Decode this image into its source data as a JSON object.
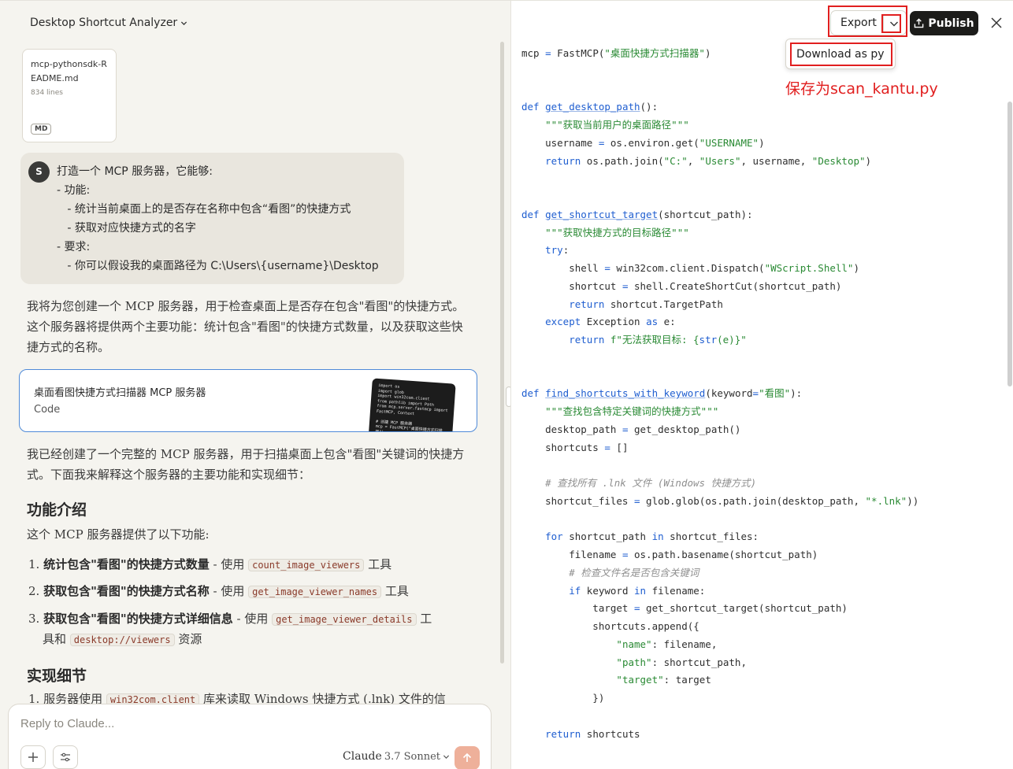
{
  "left": {
    "title": "Desktop Shortcut Analyzer",
    "file": {
      "name": "mcp-pythonsdk-README.md",
      "lines": "834 lines",
      "badge": "MD"
    },
    "user": {
      "avatar": "S",
      "text": "打造一个 MCP 服务器，它能够:\n- 功能:\n   - 统计当前桌面上的是否存在名称中包含“看图”的快捷方式\n   - 获取对应快捷方式的名字\n- 要求:\n   - 你可以假设我的桌面路径为 C:\\Users\\{username}\\Desktop"
    },
    "response_intro": "我将为您创建一个 MCP 服务器，用于检查桌面上是否存在包含\"看图\"的快捷方式。这个服务器将提供两个主要功能：统计包含\"看图\"的快捷方式数量，以及获取这些快捷方式的名称。",
    "artifact": {
      "title": "桌面看图快捷方式扫描器 MCP 服务器",
      "type": "Code",
      "thumb": "import os\nimport glob\nimport win32com.client\nfrom pathlib import Path\nfrom mcp.server.fastmcp import\nFastMCP, Context\n\n# 创建 MCP 服务器\nmcp = FastMCP(\"桌面快捷方式扫描\n器\")"
    },
    "response_2": "我已经创建了一个完整的 MCP 服务器，用于扫描桌面上包含\"看图\"关键词的快捷方式。下面我来解释这个服务器的主要功能和实现细节：",
    "h_features": "功能介绍",
    "features_intro": "这个 MCP 服务器提供了以下功能:",
    "features": [
      {
        "num": "1.",
        "bold": "统计包含\"看图\"的快捷方式数量",
        "mid": " - 使用 ",
        "code": "count_image_viewers",
        "tail": " 工具"
      },
      {
        "num": "2.",
        "bold": "获取包含\"看图\"的快捷方式名称",
        "mid": " - 使用 ",
        "code": "get_image_viewer_names",
        "tail": " 工具"
      },
      {
        "num": "3.",
        "bold": "获取包含\"看图\"的快捷方式详细信息",
        "mid": " - 使用 ",
        "code": "get_image_viewer_details",
        "tail": " 工",
        "line2a": "具和 ",
        "code2": "desktop://viewers",
        "line2b": " 资源"
      }
    ],
    "h_impl": "实现细节",
    "impl_item": {
      "num": "1.",
      "pre": "服务器使用 ",
      "code": "win32com.client",
      "post": " 库来读取 Windows 快捷方式 (.lnk) 文件的信"
    },
    "composer": {
      "placeholder": "Reply to Claude...",
      "model": "Claude",
      "version": "3.7 Sonnet"
    }
  },
  "right": {
    "export_label": "Export",
    "publish_label": "Publish",
    "menu_item": "Download as py",
    "annotation": "保存为scan_kantu.py",
    "code_lines": [
      [
        [
          "",
          "mcp "
        ],
        [
          "kw",
          "="
        ],
        [
          "",
          " FastMCP("
        ],
        [
          "st",
          "\"桌面快捷方式扫描器\""
        ],
        [
          "",
          ")"
        ]
      ],
      [],
      [],
      [
        [
          "kw",
          "def "
        ],
        [
          "fn",
          "get_desktop_path"
        ],
        [
          "",
          "():"
        ]
      ],
      [
        [
          "",
          "    "
        ],
        [
          "st",
          "\"\"\"获取当前用户的桌面路径\"\"\""
        ]
      ],
      [
        [
          "",
          "    username "
        ],
        [
          "kw",
          "="
        ],
        [
          "",
          " os.environ.get("
        ],
        [
          "st",
          "\"USERNAME\""
        ],
        [
          "",
          ")"
        ]
      ],
      [
        [
          "",
          "    "
        ],
        [
          "kw",
          "return"
        ],
        [
          "",
          " os.path.join("
        ],
        [
          "st",
          "\"C:\""
        ],
        [
          "",
          ", "
        ],
        [
          "st",
          "\"Users\""
        ],
        [
          "",
          ", username, "
        ],
        [
          "st",
          "\"Desktop\""
        ],
        [
          "",
          ")"
        ]
      ],
      [],
      [],
      [
        [
          "kw",
          "def "
        ],
        [
          "fn",
          "get_shortcut_target"
        ],
        [
          "",
          "(shortcut_path):"
        ]
      ],
      [
        [
          "",
          "    "
        ],
        [
          "st",
          "\"\"\"获取快捷方式的目标路径\"\"\""
        ]
      ],
      [
        [
          "",
          "    "
        ],
        [
          "kw",
          "try"
        ],
        [
          "",
          ":"
        ]
      ],
      [
        [
          "",
          "        shell "
        ],
        [
          "kw",
          "="
        ],
        [
          "",
          " win32com.client.Dispatch("
        ],
        [
          "st",
          "\"WScript.Shell\""
        ],
        [
          "",
          ")"
        ]
      ],
      [
        [
          "",
          "        shortcut "
        ],
        [
          "kw",
          "="
        ],
        [
          "",
          " shell.CreateShortCut(shortcut_path)"
        ]
      ],
      [
        [
          "",
          "        "
        ],
        [
          "kw",
          "return"
        ],
        [
          "",
          " shortcut.TargetPath"
        ]
      ],
      [
        [
          "",
          "    "
        ],
        [
          "kw",
          "except"
        ],
        [
          "",
          " Exception "
        ],
        [
          "kw",
          "as"
        ],
        [
          "",
          " e:"
        ]
      ],
      [
        [
          "",
          "        "
        ],
        [
          "kw",
          "return"
        ],
        [
          "",
          " "
        ],
        [
          "st",
          "f\"无法获取目标: {"
        ],
        [
          "kw",
          "str"
        ],
        [
          "st",
          "(e)}\""
        ]
      ],
      [],
      [],
      [
        [
          "kw",
          "def "
        ],
        [
          "fn",
          "find_shortcuts_with_keyword"
        ],
        [
          "",
          "(keyword"
        ],
        [
          "kw",
          "="
        ],
        [
          "st",
          "\"看图\""
        ],
        [
          "",
          "):"
        ]
      ],
      [
        [
          "",
          "    "
        ],
        [
          "st",
          "\"\"\"查找包含特定关键词的快捷方式\"\"\""
        ]
      ],
      [
        [
          "",
          "    desktop_path "
        ],
        [
          "kw",
          "="
        ],
        [
          "",
          " get_desktop_path()"
        ]
      ],
      [
        [
          "",
          "    shortcuts "
        ],
        [
          "kw",
          "="
        ],
        [
          "",
          " []"
        ]
      ],
      [],
      [
        [
          "",
          "    "
        ],
        [
          "cm",
          "# 查找所有 .lnk 文件 (Windows 快捷方式)"
        ]
      ],
      [
        [
          "",
          "    shortcut_files "
        ],
        [
          "kw",
          "="
        ],
        [
          "",
          " glob.glob(os.path.join(desktop_path, "
        ],
        [
          "st",
          "\"*.lnk\""
        ],
        [
          "",
          "))"
        ]
      ],
      [],
      [
        [
          "",
          "    "
        ],
        [
          "kw",
          "for"
        ],
        [
          "",
          " shortcut_path "
        ],
        [
          "kw",
          "in"
        ],
        [
          "",
          " shortcut_files:"
        ]
      ],
      [
        [
          "",
          "        filename "
        ],
        [
          "kw",
          "="
        ],
        [
          "",
          " os.path.basename(shortcut_path)"
        ]
      ],
      [
        [
          "",
          "        "
        ],
        [
          "cm",
          "# 检查文件名是否包含关键词"
        ]
      ],
      [
        [
          "",
          "        "
        ],
        [
          "kw",
          "if"
        ],
        [
          "",
          " keyword "
        ],
        [
          "kw",
          "in"
        ],
        [
          "",
          " filename:"
        ]
      ],
      [
        [
          "",
          "            target "
        ],
        [
          "kw",
          "="
        ],
        [
          "",
          " get_shortcut_target(shortcut_path)"
        ]
      ],
      [
        [
          "",
          "            shortcuts.append({"
        ]
      ],
      [
        [
          "",
          "                "
        ],
        [
          "st",
          "\"name\""
        ],
        [
          "",
          ": filename,"
        ]
      ],
      [
        [
          "",
          "                "
        ],
        [
          "st",
          "\"path\""
        ],
        [
          "",
          ": shortcut_path,"
        ]
      ],
      [
        [
          "",
          "                "
        ],
        [
          "st",
          "\"target\""
        ],
        [
          "",
          ": target"
        ]
      ],
      [
        [
          "",
          "            })"
        ]
      ],
      [],
      [
        [
          "",
          "    "
        ],
        [
          "kw",
          "return"
        ],
        [
          "",
          " shortcuts"
        ]
      ]
    ]
  },
  "colors": {
    "highlight": "#e11f1f",
    "artifact_border": "#4f8ad8",
    "send": "#eeb09a",
    "keyword": "#1f5ed0",
    "string": "#2a8a34"
  },
  "icons": [
    "chevron-down-icon",
    "upload-icon",
    "close-icon",
    "plus-icon",
    "settings-sliders-icon",
    "arrow-up-icon"
  ]
}
